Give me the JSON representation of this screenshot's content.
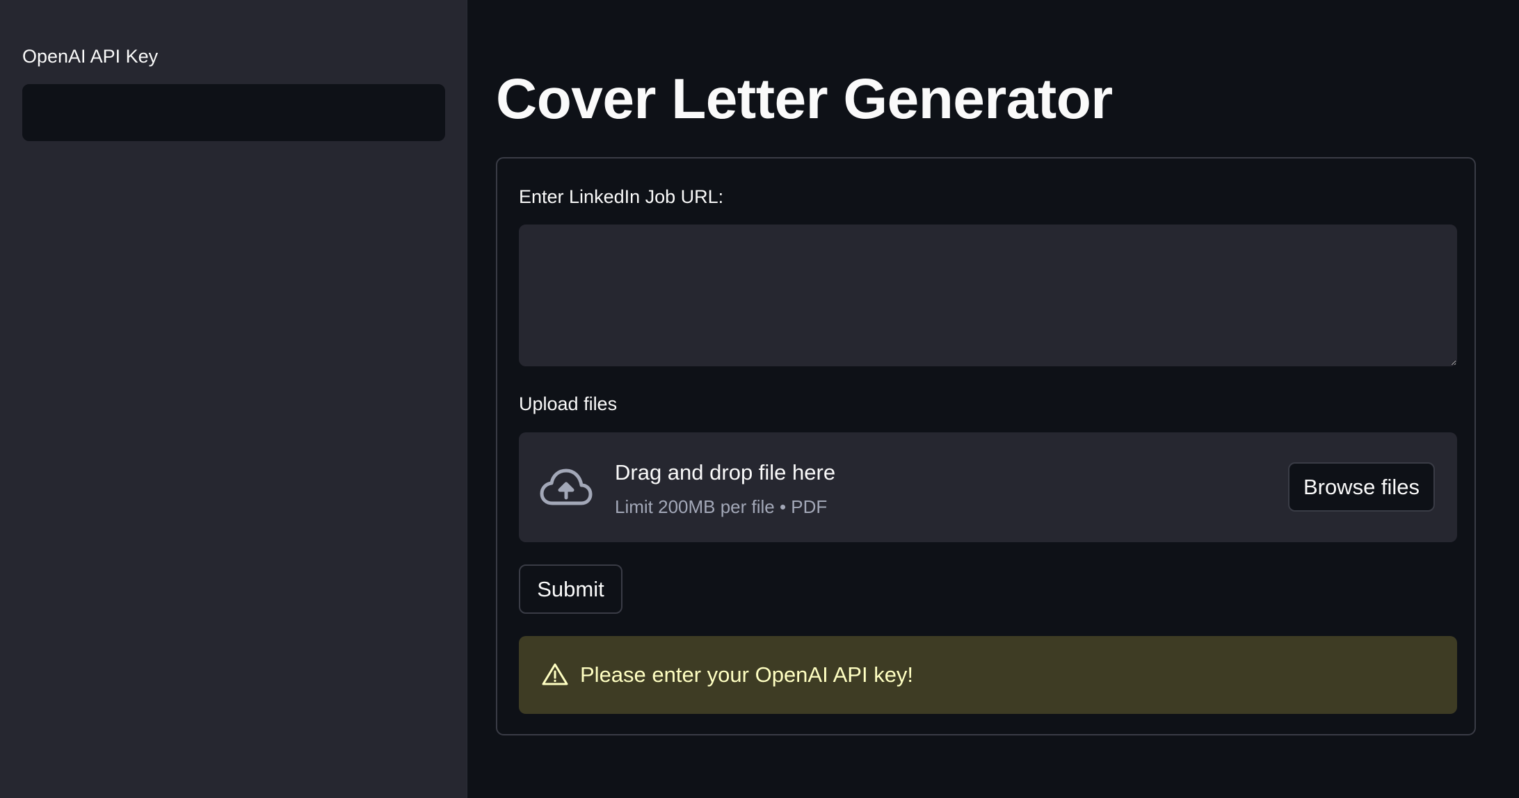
{
  "sidebar": {
    "api_key_label": "OpenAI API Key",
    "api_key_value": ""
  },
  "main": {
    "title": "Cover Letter Generator",
    "form": {
      "url_label": "Enter LinkedIn Job URL:",
      "url_value": "",
      "upload_label": "Upload files",
      "dropzone": {
        "title": "Drag and drop file here",
        "subtitle": "Limit 200MB per file • PDF",
        "browse_label": "Browse files",
        "icon": "cloud-upload-icon"
      },
      "submit_label": "Submit",
      "warning": {
        "icon": "warning-icon",
        "text": "Please enter your OpenAI API key!"
      }
    }
  },
  "colors": {
    "background": "#0e1117",
    "sidebar": "#262730",
    "input": "#262730",
    "warning_bg": "#3e3c24",
    "warning_text": "#ffffc2",
    "muted_text": "#a3a8b8"
  }
}
